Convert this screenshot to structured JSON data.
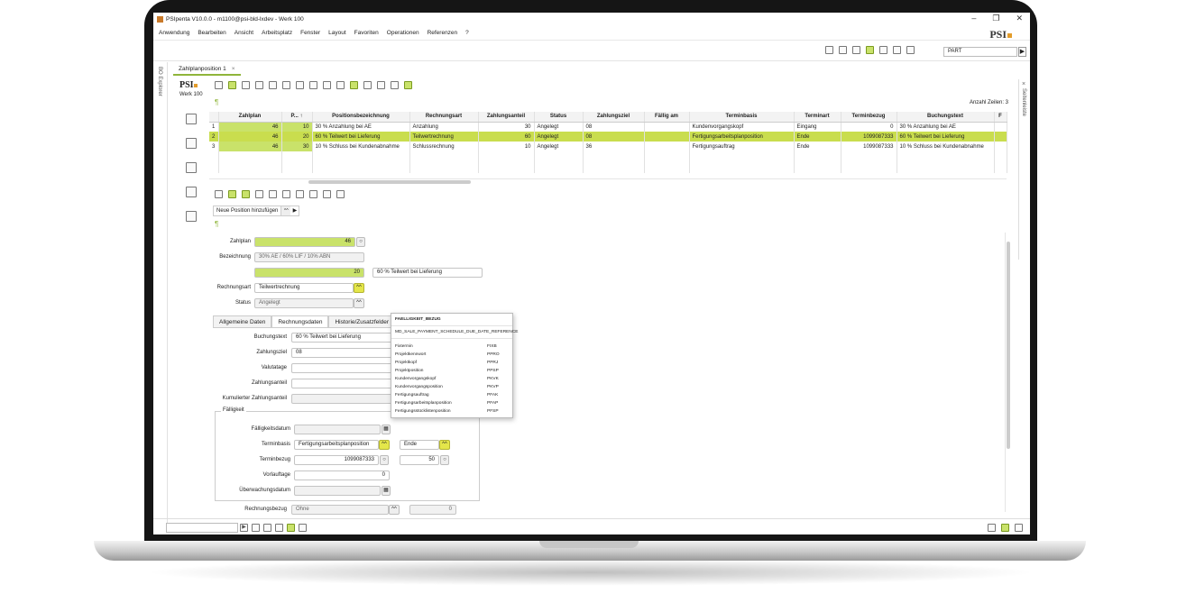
{
  "window": {
    "title": "PSIpenta V10.0.0 - m1100@psi-bld-lxdev - Werk 100",
    "minimize": "–",
    "maximize": "❐",
    "close": "✕"
  },
  "menu": [
    "Anwendung",
    "Bearbeiten",
    "Ansicht",
    "Arbeitsplatz",
    "Fenster",
    "Layout",
    "Favoriten",
    "Operationen",
    "Referenzen",
    "?"
  ],
  "logo": {
    "text": "PSI"
  },
  "toolbar": {
    "part_value": "PART",
    "go": "▶"
  },
  "sidebar": {
    "bo_explorer": "BO Explorer",
    "seitenleiste": "Seitenleiste",
    "close": "×"
  },
  "tabs": [
    {
      "label": "Zahlplanposition 1",
      "close": "×"
    }
  ],
  "context": {
    "logo": "PSI",
    "werk": "Werk 100"
  },
  "grid": {
    "count_label": "Anzahl Zeilen: 3",
    "columns": [
      "",
      "Zahlplan",
      "P... ↑",
      "Positionsbezeichnung",
      "Rechnungsart",
      "Zahlungsanteil",
      "Status",
      "Zahlungsziel",
      "Fällig am",
      "Terminbasis",
      "Terminart",
      "Terminbezug",
      "Buchungstext",
      "F"
    ],
    "rows": [
      [
        "1",
        "46",
        "10",
        "30 % Anzahlung bei AE",
        "Anzahlung",
        "30",
        "Angelegt",
        "08",
        "",
        "Kundenvorgangskopf",
        "Eingang",
        "0",
        "30 % Anzahlung bei AE",
        ""
      ],
      [
        "2",
        "46",
        "20",
        "60 % Teilwert bei Lieferung",
        "Teilwertrechnung",
        "60",
        "Angelegt",
        "08",
        "",
        "Fertigungsarbeitsplanposition",
        "Ende",
        "1099087333",
        "60 % Teilwert bei Lieferung",
        ""
      ],
      [
        "3",
        "46",
        "30",
        "10 % Schluss bei Kundenabnahme",
        "Schlussrechnung",
        "10",
        "Angelegt",
        "36",
        "",
        "Fertigungsauftrag",
        "Ende",
        "1099087333",
        "10 % Schluss bei Kundenabnahme",
        ""
      ]
    ]
  },
  "form": {
    "new_position_label": "Neue Position hinzufügen",
    "new_position_dd": "^^",
    "new_position_arrow": "▶",
    "zahlplan_label": "Zahlplan",
    "zahlplan_value": "46",
    "bezeichnung_label": "Bezeichnung",
    "bezeichnung_value": "30% AE / 60% LIF / 10% ABN",
    "position_value": "20",
    "position_text": "60 % Teilwert bei Lieferung",
    "rechnungsart_label": "Rechnungsart",
    "rechnungsart_value": "Teilwertrechnung",
    "status_label": "Status",
    "status_value": "Angelegt",
    "dd_symbol": "^^",
    "subtabs": [
      "Allgemeine Daten",
      "Rechnungsdaten",
      "Historie/Zusatzfelder"
    ],
    "buchungstext_label": "Buchungstext",
    "buchungstext_value": "60 % Teilwert bei Lieferung",
    "zahlungsziel_label": "Zahlungsziel",
    "zahlungsziel_value": "08",
    "valutatage_label": "Valutatage",
    "zahlungsanteil_label": "Zahlungsanteil",
    "kumuliert_label": "Kumulierter Zahlungsanteil",
    "faelligkeit_group": "Fälligkeit",
    "faelligkeitsdatum_label": "Fälligkeitsdatum",
    "terminbasis_label": "Terminbasis",
    "terminbasis_value": "Fertigungsarbeitsplanposition",
    "terminart_value": "Ende",
    "terminbezug_label": "Terminbezug",
    "terminbezug_value": "1099087333",
    "terminbezug_pos": "50",
    "vorlauftage_label": "Vorlauftage",
    "vorlauftage_value": "0",
    "ueberwachungsdatum_label": "Überwachungsdatum",
    "rechnungsbezug_label": "Rechnungsbezug",
    "rechnungsbezug_value": "Ohne",
    "rechnungsbezug_num": "0"
  },
  "popup": {
    "header": "FAELLIGKEIT_BEZUG",
    "key": "MD_SALE_PAYMENT_SCHEDULE_DUE_DATE_REFERENCE",
    "rows": [
      [
        "Fixtermin",
        "FIXB"
      ],
      [
        "Projektkennwort",
        "PPRO"
      ],
      [
        "Projektkopf",
        "PPRJ"
      ],
      [
        "Projektposition",
        "PPSP"
      ],
      [
        "Kundenvorgangskopf",
        "PKVK"
      ],
      [
        "Kundenvorgangsposition",
        "PKVP"
      ],
      [
        "Fertigungsauftrag",
        "PFAK"
      ],
      [
        "Fertigungsarbeitsplanposition",
        "PFAP"
      ],
      [
        "Fertigungsstücklistenposition",
        "PFSP"
      ]
    ]
  },
  "statusbar": {
    "go": "▶"
  },
  "colors": {
    "accent_green": "#c9e26a",
    "selection": "#c9dd4e",
    "dropdown_yellow": "#e4e64a",
    "logo_orange": "#e39c2b"
  },
  "icons": [
    "save-icon",
    "delete-icon",
    "copy-icon",
    "search-icon",
    "mail-icon",
    "excel-icon",
    "first-icon",
    "prev-icon",
    "next-icon",
    "last-icon",
    "pin-icon",
    "calendar-icon"
  ]
}
